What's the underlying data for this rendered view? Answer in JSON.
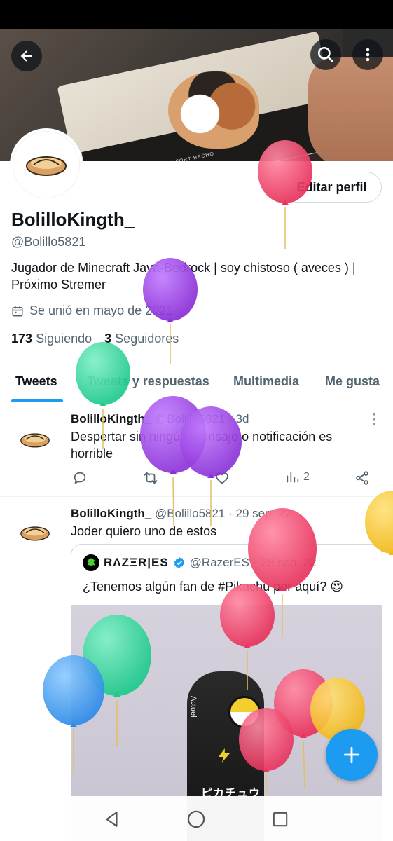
{
  "banner": {
    "box_print": "CALZADO DE CONFORT HECHO"
  },
  "header": {
    "back_icon": "arrow-left-icon",
    "search_icon": "search-icon",
    "more_icon": "more-vertical-icon"
  },
  "profile": {
    "edit_label": "Editar perfil",
    "display_name": "BolilloKingth_",
    "handle": "@Bolillo5821",
    "bio": "Jugador de Minecraft Java-Bedrock | soy chistoso ( aveces ) | Próximo Stremer",
    "joined": "Se unió en mayo de 2021",
    "following_count": "173",
    "following_label": "Siguiendo",
    "followers_count": "3",
    "followers_label": "Seguidores"
  },
  "tabs": [
    "Tweets",
    "Tweets y respuestas",
    "Multimedia",
    "Me gusta"
  ],
  "tweets": [
    {
      "name": "BolilloKingth_",
      "handle": "@Bolillo5821",
      "time": "· 3d",
      "text": "Despertar sin ningún mensaje o notificación es horrible",
      "views": "2"
    },
    {
      "name": "BolilloKingth_",
      "handle": "@Bolillo5821",
      "time": "· 29 sep. 22",
      "text": "Joder quiero uno de estos",
      "quote": {
        "name": "RΛZΞR|ES",
        "handle": "@RazerES",
        "time": "· 28 sep. 22",
        "text": "¿Tenemos algún fan de #Pikachu por aquí? 😍",
        "mouse_side_text": "Actuel",
        "mouse_jp_text": "ピカチュウ"
      }
    }
  ],
  "colors": {
    "accent": "#1d9bf0",
    "text_primary": "#0f1419",
    "text_secondary": "#536471",
    "verified": "#1d9bf0",
    "balloon_red": "#f0446a",
    "balloon_purple": "#9b3fe0",
    "balloon_green": "#2fd69c",
    "balloon_blue": "#3c9cf0",
    "balloon_yellow": "#f5c730"
  }
}
